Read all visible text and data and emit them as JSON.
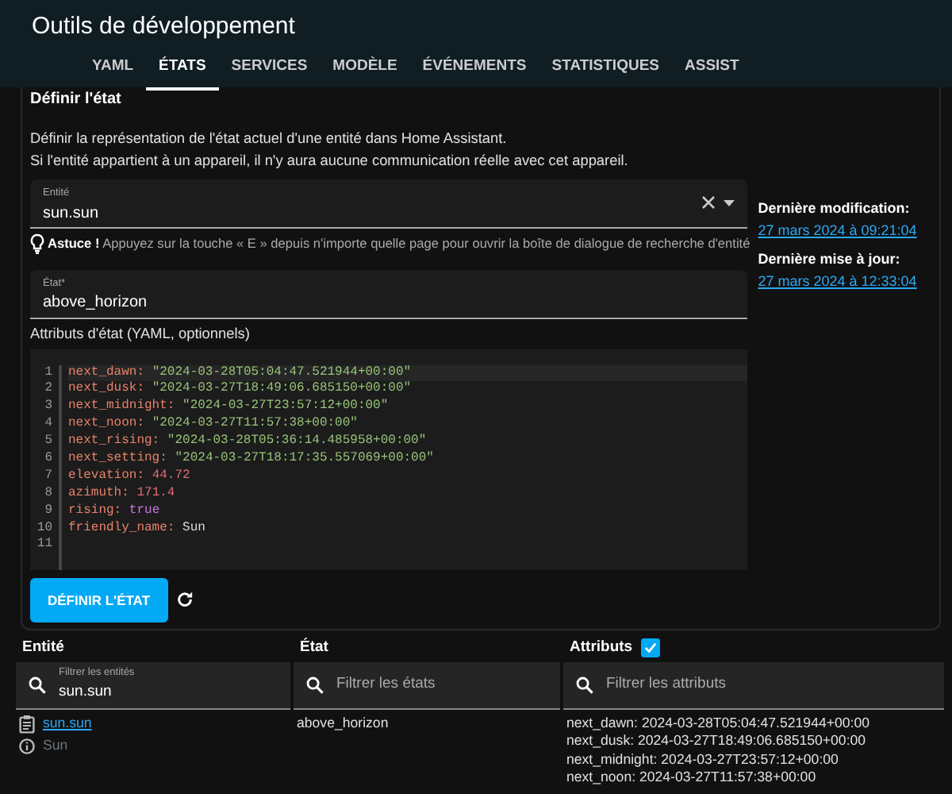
{
  "window": {
    "title": "Outils de développement"
  },
  "tabs": [
    {
      "label": "YAML",
      "selected": false
    },
    {
      "label": "ÉTATS",
      "selected": true
    },
    {
      "label": "SERVICES",
      "selected": false
    },
    {
      "label": "MODÈLE",
      "selected": false
    },
    {
      "label": "ÉVÉNEMENTS",
      "selected": false
    },
    {
      "label": "STATISTIQUES",
      "selected": false
    },
    {
      "label": "ASSIST",
      "selected": false
    }
  ],
  "set_state": {
    "title": "Définir l'état",
    "description": [
      "Définir la représentation de l'état actuel d'une entité dans Home Assistant.",
      "Si l'entité appartient à un appareil, il n'y aura aucune communication réelle avec cet appareil."
    ],
    "entity_field": {
      "label": "Entité",
      "value": "sun.sun"
    },
    "tip": "**Astuce !** Appuyez sur la touche « E » depuis n'importe quelle page pour ouvrir la boîte de dialogue de recherche d'entité",
    "state_field": {
      "label": "État*",
      "value": "above_horizon"
    },
    "attributes_label": "Attributs d'état (YAML, optionnels)",
    "code_lines": [
      {
        "number": "1",
        "key": "next_dawn:",
        "value": "\"2024-03-28T05:04:47.521944+00:00\"",
        "kind": "string"
      },
      {
        "number": "2",
        "key": "next_dusk:",
        "value": "\"2024-03-27T18:49:06.685150+00:00\"",
        "kind": "string"
      },
      {
        "number": "3",
        "key": "next_midnight:",
        "value": "\"2024-03-27T23:57:12+00:00\"",
        "kind": "string"
      },
      {
        "number": "4",
        "key": "next_noon:",
        "value": "\"2024-03-27T11:57:38+00:00\"",
        "kind": "string"
      },
      {
        "number": "5",
        "key": "next_rising:",
        "value": "\"2024-03-28T05:36:14.485958+00:00\"",
        "kind": "string"
      },
      {
        "number": "6",
        "key": "next_setting:",
        "value": "\"2024-03-27T18:17:35.557069+00:00\"",
        "kind": "string"
      },
      {
        "number": "7",
        "key": "elevation:",
        "value": "44.72",
        "kind": "number"
      },
      {
        "number": "8",
        "key": "azimuth:",
        "value": "171.4",
        "kind": "number"
      },
      {
        "number": "9",
        "key": "rising:",
        "value": "true",
        "kind": "boolean"
      },
      {
        "number": "10",
        "key": "friendly_name:",
        "value": "Sun",
        "kind": "plain"
      },
      {
        "number": "11",
        "kind": "empty"
      }
    ],
    "button": "DÉFINIR L'ÉTAT",
    "last_changed": {
      "label": "Dernière modification:",
      "value": "27 mars 2024 à 09:21:04"
    },
    "last_updated": {
      "label": "Dernière mise à jour:",
      "value": "27 mars 2024 à 12:33:04"
    }
  },
  "table": {
    "columns": [
      {
        "label": "Entité"
      },
      {
        "label": "État"
      },
      {
        "label": "Attributs",
        "checkbox": {
          "checked": true
        }
      }
    ],
    "filters": [
      {
        "label": "Filtrer les entités",
        "value": "sun.sun"
      },
      {
        "placeholder": "Filtrer les états"
      },
      {
        "placeholder": "Filtrer les attributs"
      }
    ],
    "rows": [
      {
        "entity": "sun.sun",
        "name": "Sun",
        "state": "above_horizon",
        "attributes": [
          "next_dawn: 2024-03-28T05:04:47.521944+00:00",
          "next_dusk: 2024-03-27T18:49:06.685150+00:00",
          "next_midnight: 2024-03-27T23:57:12+00:00",
          "next_noon: 2024-03-27T11:57:38+00:00"
        ]
      }
    ]
  }
}
